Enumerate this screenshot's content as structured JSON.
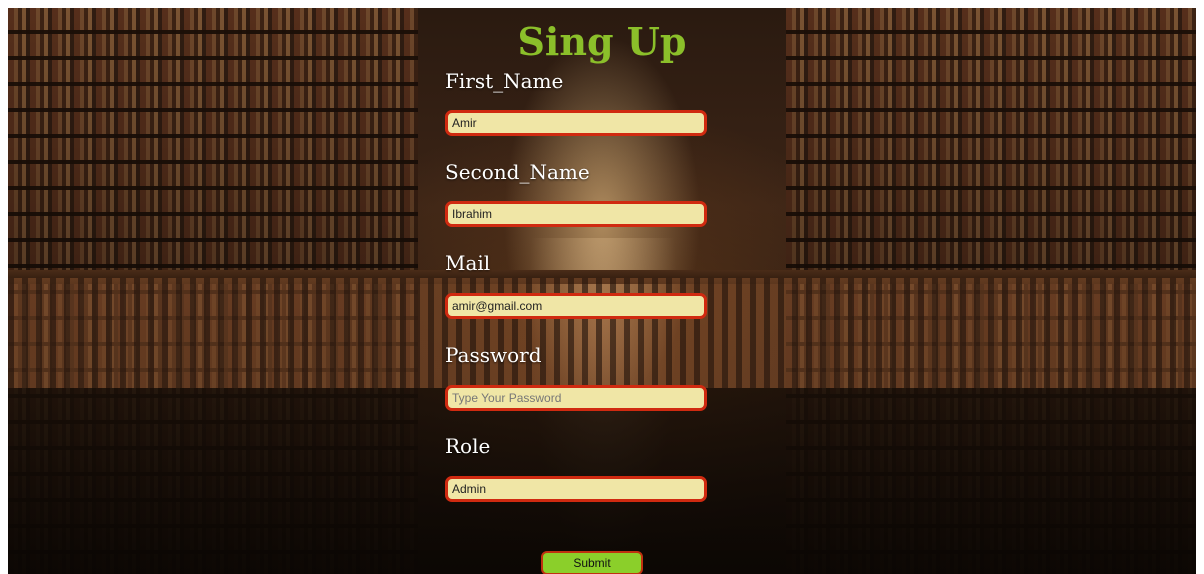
{
  "form": {
    "title": "Sing Up",
    "fields": {
      "first_name": {
        "label": "First_Name",
        "value": "Amir",
        "placeholder": ""
      },
      "second_name": {
        "label": "Second_Name",
        "value": "Ibrahim",
        "placeholder": ""
      },
      "mail": {
        "label": "Mail",
        "value": "amir@gmail.com",
        "placeholder": ""
      },
      "password": {
        "label": "Password",
        "value": "",
        "placeholder": "Type Your Password"
      },
      "role": {
        "label": "Role",
        "value": "Admin",
        "placeholder": ""
      }
    },
    "submit_label": "Submit"
  },
  "colors": {
    "title": "#8bbf2a",
    "input_background": "#f0e6a6",
    "input_border": "#d02a10",
    "submit_background": "#8bcf2a",
    "label_text": "#ffffff"
  }
}
